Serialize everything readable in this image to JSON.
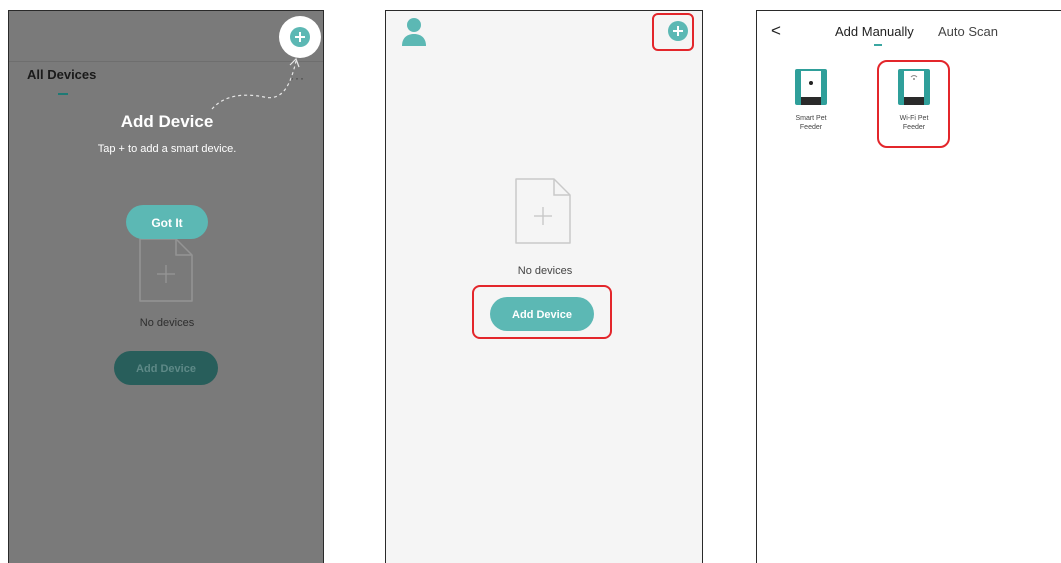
{
  "colors": {
    "accent": "#5cb8b4",
    "accent_dark": "#285e5b",
    "highlight_red": "#e3262b",
    "overlay_gray": "#7a7a7a"
  },
  "screen1": {
    "title": "All Devices",
    "more": "···",
    "guide_title": "Add Device",
    "guide_subtitle": "Tap + to add a smart device.",
    "got_it": "Got It",
    "empty_text": "No devices",
    "add_device": "Add Device",
    "icons": [
      "plus-circle-icon",
      "more-icon",
      "empty-document-icon"
    ]
  },
  "screen2": {
    "empty_text": "No devices",
    "add_device": "Add Device",
    "icons": [
      "user-avatar-icon",
      "plus-circle-icon",
      "empty-document-icon"
    ]
  },
  "screen3": {
    "back": "<",
    "tabs": [
      {
        "label": "Add Manually",
        "active": true
      },
      {
        "label": "Auto Scan",
        "active": false
      }
    ],
    "devices": [
      {
        "label_line1": "Smart Pet",
        "label_line2": "Feeder",
        "icon": "smart-pet-feeder-icon"
      },
      {
        "label_line1": "Wi-Fi  Pet",
        "label_line2": "Feeder",
        "icon": "wifi-pet-feeder-icon"
      }
    ]
  }
}
